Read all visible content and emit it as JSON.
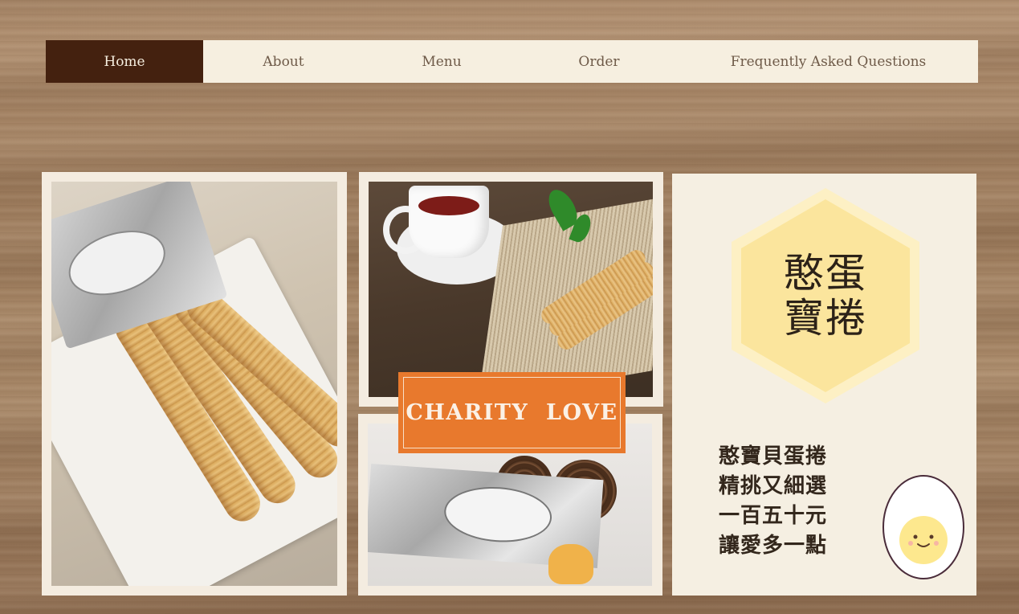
{
  "nav": {
    "items": [
      {
        "label": "Home",
        "active": true
      },
      {
        "label": "About",
        "active": false
      },
      {
        "label": "Menu",
        "active": false
      },
      {
        "label": "Order",
        "active": false
      },
      {
        "label": "Frequently Asked Questions",
        "active": false
      }
    ]
  },
  "badge": {
    "text": "CHARITY  LOVE"
  },
  "panel": {
    "logo_lines": [
      "憨蛋",
      "寶捲"
    ],
    "slogan_lines": [
      "憨寶貝蛋捲",
      "精挑又細選",
      "一百五十元",
      "讓愛多一點"
    ]
  },
  "colors": {
    "nav_active_bg": "#44210f",
    "nav_bg": "#f6efe0",
    "badge_bg": "#e8792d",
    "hexagon_fill": "#fbe7a6",
    "panel_bg": "#f5efe2"
  }
}
